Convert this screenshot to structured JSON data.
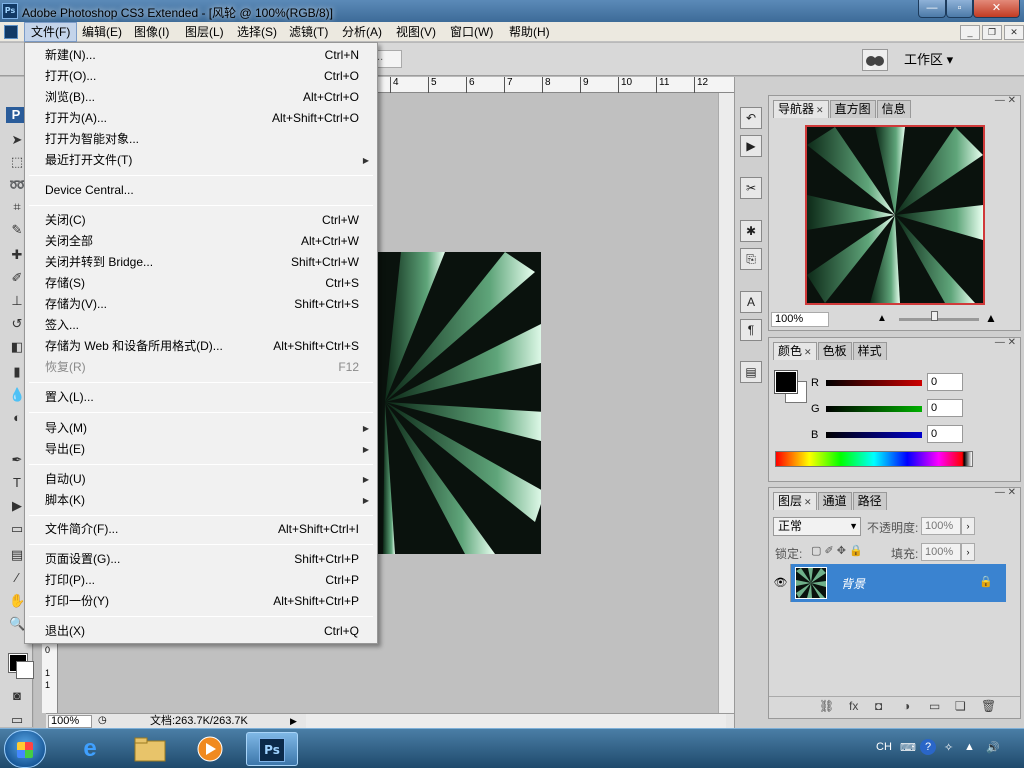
{
  "window": {
    "title": "Adobe Photoshop CS3 Extended - [风轮 @ 100%(RGB/8)]",
    "logo": "Ps"
  },
  "menubar": {
    "items": [
      "文件(F)",
      "编辑(E)",
      "图像(I)",
      "图层(L)",
      "选择(S)",
      "滤镜(T)",
      "分析(A)",
      "视图(V)",
      "窗口(W)",
      "帮助(H)"
    ]
  },
  "options": {
    "workspace_label": "工作区 ▾",
    "field_value": "..."
  },
  "file_menu": {
    "items": [
      {
        "label": "新建(N)...",
        "shortcut": "Ctrl+N"
      },
      {
        "label": "打开(O)...",
        "shortcut": "Ctrl+O"
      },
      {
        "label": "浏览(B)...",
        "shortcut": "Alt+Ctrl+O"
      },
      {
        "label": "打开为(A)...",
        "shortcut": "Alt+Shift+Ctrl+O"
      },
      {
        "label": "打开为智能对象...",
        "shortcut": ""
      },
      {
        "label": "最近打开文件(T)",
        "shortcut": ""
      },
      {
        "label": "Device Central...",
        "shortcut": ""
      },
      {
        "label": "关闭(C)",
        "shortcut": "Ctrl+W"
      },
      {
        "label": "关闭全部",
        "shortcut": "Alt+Ctrl+W"
      },
      {
        "label": "关闭并转到 Bridge...",
        "shortcut": "Shift+Ctrl+W"
      },
      {
        "label": "存储(S)",
        "shortcut": "Ctrl+S"
      },
      {
        "label": "存储为(V)...",
        "shortcut": "Shift+Ctrl+S"
      },
      {
        "label": "签入...",
        "shortcut": ""
      },
      {
        "label": "存储为 Web 和设备所用格式(D)...",
        "shortcut": "Alt+Shift+Ctrl+S"
      },
      {
        "label": "恢复(R)",
        "shortcut": "F12"
      },
      {
        "label": "置入(L)...",
        "shortcut": ""
      },
      {
        "label": "导入(M)",
        "shortcut": ""
      },
      {
        "label": "导出(E)",
        "shortcut": ""
      },
      {
        "label": "自动(U)",
        "shortcut": ""
      },
      {
        "label": "脚本(K)",
        "shortcut": ""
      },
      {
        "label": "文件简介(F)...",
        "shortcut": "Alt+Shift+Ctrl+I"
      },
      {
        "label": "页面设置(G)...",
        "shortcut": "Shift+Ctrl+P"
      },
      {
        "label": "打印(P)...",
        "shortcut": "Ctrl+P"
      },
      {
        "label": "打印一份(Y)",
        "shortcut": "Alt+Shift+Ctrl+P"
      },
      {
        "label": "退出(X)",
        "shortcut": "Ctrl+Q"
      }
    ]
  },
  "document": {
    "ruler_ticks": [
      "4",
      "5",
      "6",
      "7",
      "8",
      "9",
      "10",
      "11",
      "12"
    ],
    "ruler_v": [
      "0",
      "1",
      "1"
    ],
    "zoom": "100%",
    "info": "文档:263.7K/263.7K"
  },
  "navigator": {
    "tabs": [
      "导航器",
      "直方图",
      "信息"
    ],
    "zoom": "100%"
  },
  "color_panel": {
    "tabs": [
      "颜色",
      "色板",
      "样式"
    ],
    "channels": [
      {
        "label": "R",
        "value": "0",
        "color": "#cc0000"
      },
      {
        "label": "G",
        "value": "0",
        "color": "#00b000"
      },
      {
        "label": "B",
        "value": "0",
        "color": "#0000cc"
      }
    ]
  },
  "layers_panel": {
    "tabs": [
      "图层",
      "通道",
      "路径"
    ],
    "blend_mode": "正常",
    "opacity_label": "不透明度:",
    "opacity_value": "100%",
    "lock_label": "锁定:",
    "fill_label": "填充:",
    "fill_value": "100%",
    "layer_name": "背景",
    "footer_icons": [
      "link-icon",
      "fx-icon",
      "mask-icon",
      "adjustment-icon",
      "group-icon",
      "new-layer-icon",
      "trash-icon"
    ]
  },
  "taskbar": {
    "ime": "CH"
  }
}
